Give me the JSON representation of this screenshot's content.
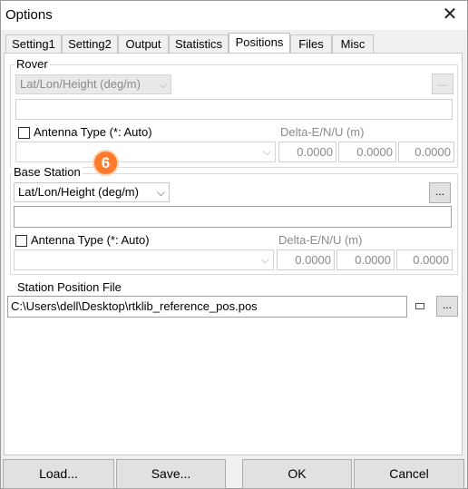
{
  "window": {
    "title": "Options",
    "close_glyph": "✕"
  },
  "tabs": [
    {
      "label": "Setting1"
    },
    {
      "label": "Setting2"
    },
    {
      "label": "Output"
    },
    {
      "label": "Statistics"
    },
    {
      "label": "Positions"
    },
    {
      "label": "Files"
    },
    {
      "label": "Misc"
    }
  ],
  "active_tab": "Positions",
  "rover": {
    "legend": "Rover",
    "format_value": "Lat/Lon/Height (deg/m)",
    "browse_label": "...",
    "position_value": "",
    "antenna_label": "Antenna Type (*: Auto)",
    "antenna_value": "",
    "delta_label": "Delta-E/N/U (m)",
    "delta_e": "0.0000",
    "delta_n": "0.0000",
    "delta_u": "0.0000"
  },
  "base": {
    "legend": "Base Station",
    "format_value": "Lat/Lon/Height (deg/m)",
    "browse_label": "...",
    "position_value": "",
    "antenna_label": "Antenna Type (*: Auto)",
    "antenna_value": "",
    "delta_label": "Delta-E/N/U (m)",
    "delta_e": "0.0000",
    "delta_n": "0.0000",
    "delta_u": "0.0000"
  },
  "annotation_badge": "6",
  "station_file": {
    "label": "Station Position File",
    "value": "C:\\Users\\dell\\Desktop\\rtklib_reference_pos.pos",
    "browse_label": "..."
  },
  "buttons": {
    "load": "Load...",
    "save": "Save...",
    "ok": "OK",
    "cancel": "Cancel"
  }
}
